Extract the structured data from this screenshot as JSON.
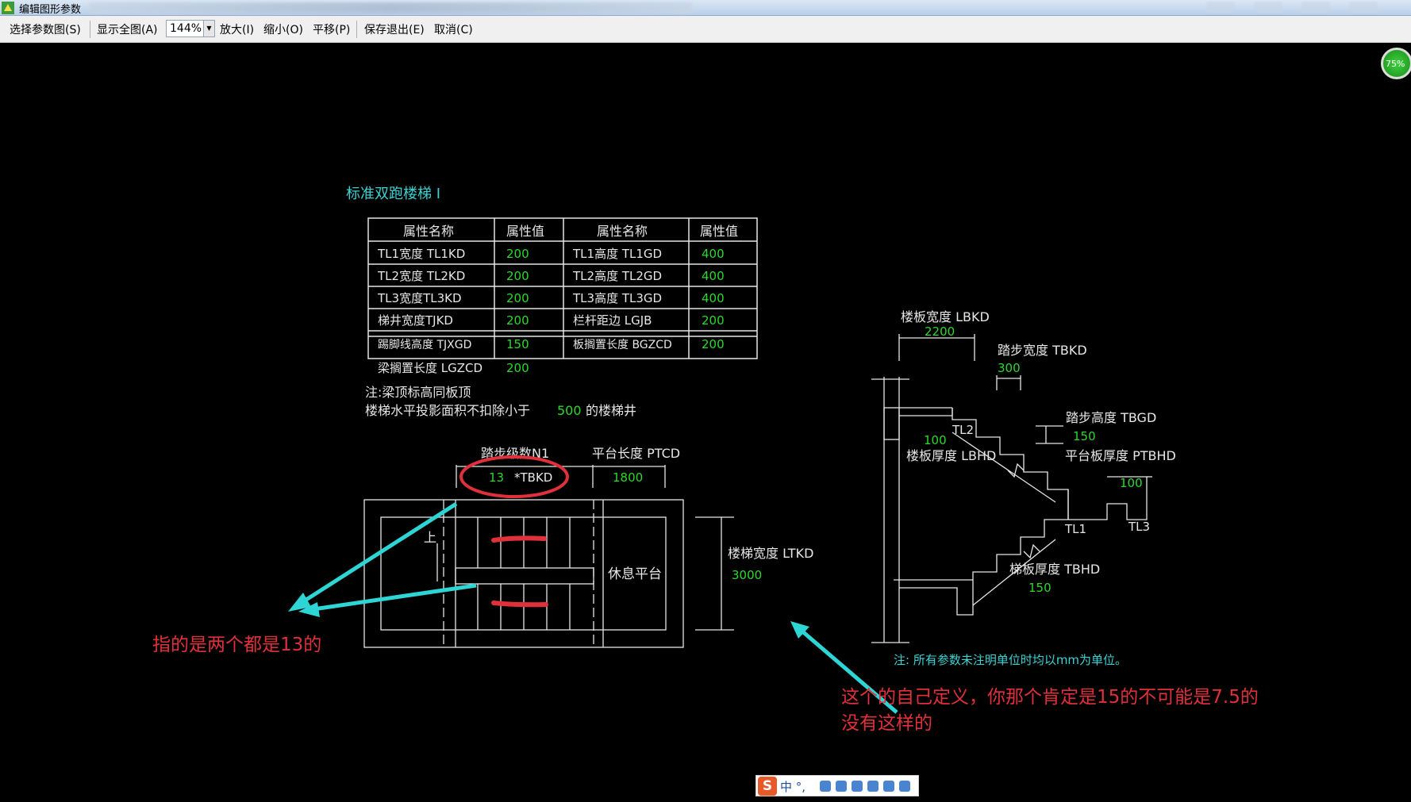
{
  "window": {
    "title": "编辑图形参数",
    "app_icon": "app-icon"
  },
  "toolbar": {
    "select_param": "选择参数图(S)",
    "show_all": "显示全图(A)",
    "zoom_value": "144%",
    "zoom_in": "放大(I)",
    "zoom_out": "缩小(O)",
    "pan": "平移(P)",
    "save_exit": "保存退出(E)",
    "cancel": "取消(C)"
  },
  "badge": {
    "text": "75%"
  },
  "drawing": {
    "title": "标准双跑楼梯 I",
    "table": {
      "headers": [
        "属性名称",
        "属性值",
        "属性名称",
        "属性值"
      ],
      "rows": [
        [
          "TL1宽度 TL1KD",
          "200",
          "TL1高度 TL1GD",
          "400"
        ],
        [
          "TL2宽度 TL2KD",
          "200",
          "TL2高度 TL2GD",
          "400"
        ],
        [
          "TL3宽度TL3KD",
          "200",
          "TL3高度 TL3GD",
          "400"
        ],
        [
          "梯井宽度TJKD",
          "200",
          "栏杆距边 LGJB",
          "200"
        ],
        [
          "踢脚线高度 TJXGD",
          "150",
          "板搁置长度 BGZCD",
          "200"
        ],
        [
          "梁搁置长度 LGZCD",
          "200",
          "",
          ""
        ]
      ]
    },
    "note_line1": "注:梁顶标高同板顶",
    "note_line2_a": "楼梯水平投影面积不扣除小于",
    "note_line2_val": "500",
    "note_line2_b": "的楼梯井",
    "plan": {
      "steps_label": "踏步级数N1",
      "steps_value": "13",
      "steps_unit": "*TBKD",
      "platform_label": "平台长度 PTCD",
      "platform_value": "1800",
      "up_label": "上",
      "rest_label": "休息平台",
      "width_label": "楼梯宽度 LTKD",
      "width_value": "3000"
    },
    "section": {
      "lbkd_label": "楼板宽度 LBKD",
      "lbkd_value": "2200",
      "tbkd_label": "踏步宽度 TBKD",
      "tbkd_value": "300",
      "tbgd_label": "踏步高度 TBGD",
      "tbgd_value": "150",
      "tl2": "TL2",
      "slab_100": "100",
      "lbhd_label": "楼板厚度 LBHD",
      "ptbhd_label": "平台板厚度 PTBHD",
      "ptbhd_value": "100",
      "tl1": "TL1",
      "tl3": "TL3",
      "tbhd_label": "梯板厚度 TBHD",
      "tbhd_value": "150"
    },
    "footnote": "注:  所有参数未注明单位时均以mm为单位。"
  },
  "annotations": {
    "left_note": "指的是两个都是13的",
    "right_note_line1": "这个的自己定义，你那个肯定是15的不可能是7.5的",
    "right_note_line2": "没有这样的"
  },
  "ime": {
    "logo": "S",
    "lang": "中 °,"
  },
  "colors": {
    "cyan": "#3ad3d3",
    "white": "#e6e6e6",
    "green": "#2dd82d",
    "red": "#e0303a"
  }
}
